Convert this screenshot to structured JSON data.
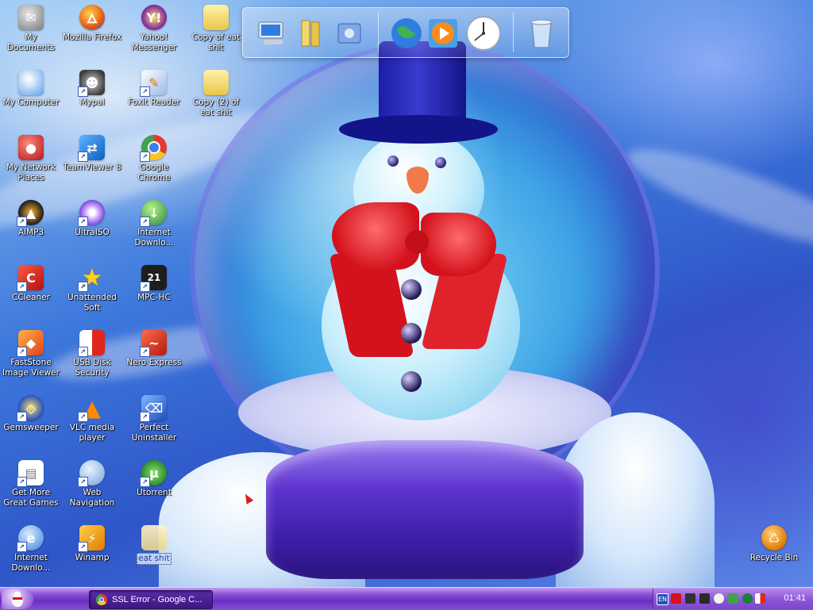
{
  "desktop": {
    "icons": [
      {
        "label": "My Documents",
        "icon": "my-documents-icon"
      },
      {
        "label": "Mozilla Firefox",
        "icon": "firefox-icon"
      },
      {
        "label": "Yahoo! Messenger",
        "icon": "yahoo-messenger-icon"
      },
      {
        "label": "Copy of eat shit",
        "icon": "folder-icon"
      },
      {
        "label": "My Computer",
        "icon": "my-computer-icon"
      },
      {
        "label": "Mypal",
        "icon": "mypal-icon"
      },
      {
        "label": "Foxit Reader",
        "icon": "foxit-reader-icon"
      },
      {
        "label": "Copy (2) of eat shit",
        "icon": "folder-icon"
      },
      {
        "label": "My Network Places",
        "icon": "network-places-icon"
      },
      {
        "label": "TeamViewer 8",
        "icon": "teamviewer-icon"
      },
      {
        "label": "Google Chrome",
        "icon": "chrome-icon"
      },
      {
        "label": "AIMP3",
        "icon": "aimp-icon"
      },
      {
        "label": "UltraISO",
        "icon": "ultraiso-icon"
      },
      {
        "label": "Internet Downlo...",
        "icon": "internet-download-manager-icon"
      },
      {
        "label": "CCleaner",
        "icon": "ccleaner-icon"
      },
      {
        "label": "Unattended Soft",
        "icon": "star-icon"
      },
      {
        "label": "MPC-HC",
        "icon": "mpc-hc-icon"
      },
      {
        "label": "FastStone Image Viewer",
        "icon": "faststone-icon"
      },
      {
        "label": "USB Disk Security",
        "icon": "shield-icon"
      },
      {
        "label": "Nero Express",
        "icon": "nero-icon"
      },
      {
        "label": "Gemsweeper",
        "icon": "gemsweeper-icon"
      },
      {
        "label": "VLC media player",
        "icon": "vlc-icon"
      },
      {
        "label": "Perfect Uninstaller",
        "icon": "uninstaller-icon"
      },
      {
        "label": "Get More Great Games",
        "icon": "games-icon"
      },
      {
        "label": "Web Navigation",
        "icon": "web-navigation-icon"
      },
      {
        "label": "Utorrent",
        "icon": "utorrent-icon"
      },
      {
        "label": "Internet Downlo...",
        "icon": "internet-download-manager-icon"
      },
      {
        "label": "Winamp",
        "icon": "winamp-icon"
      },
      {
        "label": "eat shit",
        "icon": "folder-icon"
      },
      {
        "label": "Recycle Bin",
        "icon": "recycle-bin-icon"
      }
    ]
  },
  "dock": {
    "items": [
      "my-computer-icon",
      "documents-icon",
      "control-panel-icon",
      "globe-icon",
      "media-player-icon",
      "clock-icon",
      "trash-icon"
    ]
  },
  "taskbar": {
    "window_title": "SSL Error - Google C...",
    "tray_lang": "EN",
    "clock": "01:41"
  },
  "colors": {
    "taskbar": "#8a4fd6",
    "wallpaper": "#3d78dc"
  }
}
